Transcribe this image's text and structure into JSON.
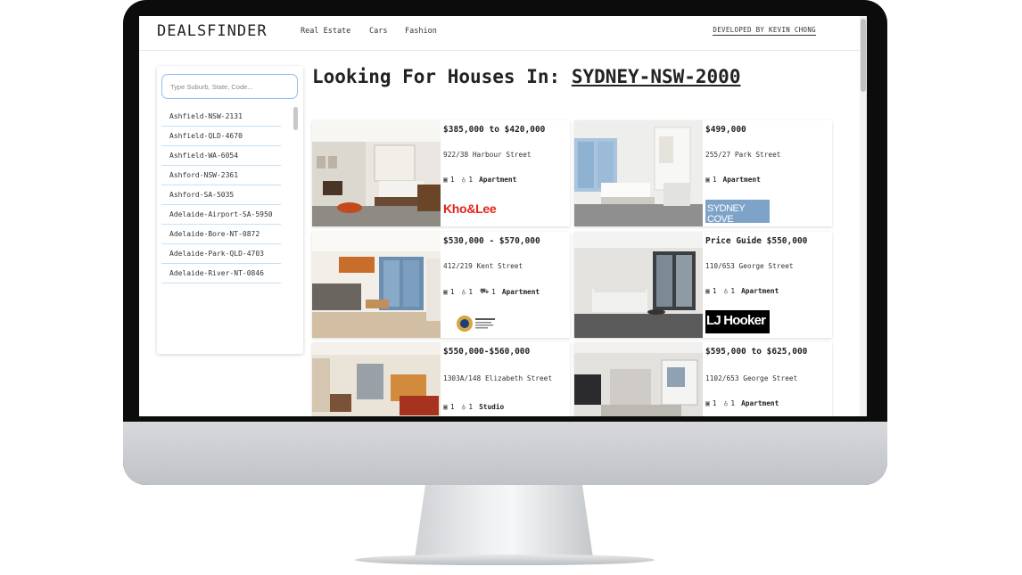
{
  "header": {
    "brand": "DEALSFINDER",
    "nav": [
      "Real Estate",
      "Cars",
      "Fashion"
    ],
    "developer": "DEVELOPED BY KEVIN CHONG"
  },
  "search": {
    "placeholder": "Type Suburb, State, Code..."
  },
  "suburbs": [
    "Ashfield-NSW-2131",
    "Ashfield-QLD-4670",
    "Ashfield-WA-6054",
    "Ashford-NSW-2361",
    "Ashford-SA-5035",
    "Adelaide-Airport-SA-5950",
    "Adelaide-Bore-NT-0872",
    "Adelaide-Park-QLD-4703",
    "Adelaide-River-NT-0846"
  ],
  "page": {
    "heading_prefix": "Looking For Houses In:",
    "location": "SYDNEY-NSW-2000"
  },
  "listings": [
    {
      "price": "$385,000 to $420,000",
      "address": "922/38 Harbour Street",
      "beds": "1",
      "baths": "1",
      "cars": "",
      "type": "Apartment",
      "agency": "Kho&Lee"
    },
    {
      "price": "$499,000",
      "address": "255/27 Park Street",
      "beds": "1",
      "baths": "",
      "cars": "",
      "type": "Apartment",
      "agency": "SYDNEY COVE"
    },
    {
      "price": "$530,000 - $570,000",
      "address": "412/219 Kent Street",
      "beds": "1",
      "baths": "1",
      "cars": "1",
      "type": "Apartment",
      "agency": ""
    },
    {
      "price": "Price Guide $550,000",
      "address": "110/653 George Street",
      "beds": "1",
      "baths": "1",
      "cars": "",
      "type": "Apartment",
      "agency": "LJ Hooker"
    },
    {
      "price": "$550,000-$560,000",
      "address": "1303A/148 Elizabeth Street",
      "beds": "1",
      "baths": "1",
      "cars": "",
      "type": "Studio",
      "agency": ""
    },
    {
      "price": "$595,000 to $625,000",
      "address": "1102/653 George Street",
      "beds": "1",
      "baths": "1",
      "cars": "",
      "type": "Apartment",
      "agency": ""
    }
  ],
  "colors": {
    "accent_border": "#8fbff0",
    "divider": "#c6e0f5",
    "khoa_red": "#e2231a",
    "sydney_cove_bg": "#7da3c8"
  }
}
